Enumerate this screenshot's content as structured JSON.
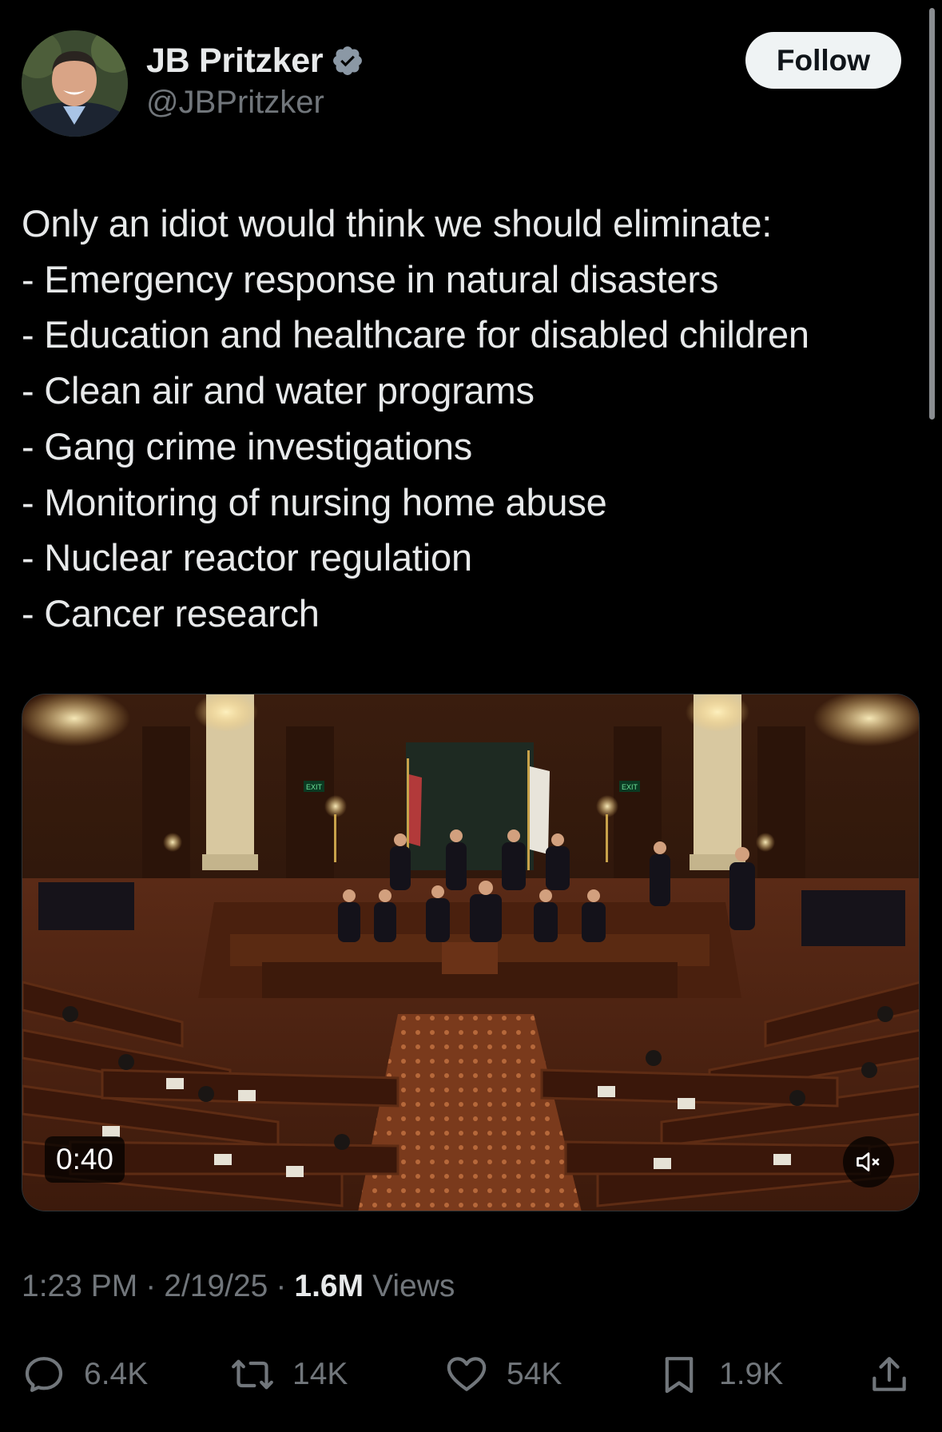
{
  "colors": {
    "background": "#000000",
    "text_primary": "#e7e9ea",
    "text_secondary": "#71767b",
    "verified_badge": "#8b98a5",
    "follow_button_bg": "#eff3f4"
  },
  "author": {
    "display_name": "JB Pritzker",
    "handle": "@JBPritzker",
    "verified_icon": "verified-badge-icon",
    "follow_label": "Follow"
  },
  "tweet": {
    "lines": [
      "Only an idiot would think we should eliminate:",
      "- Emergency response in natural disasters",
      "- Education and healthcare for disabled children",
      "- Clean air and water programs",
      "- Gang crime investigations",
      "- Monitoring of nursing home abuse",
      "- Nuclear reactor regulation",
      "- Cancer research"
    ]
  },
  "media": {
    "duration": "0:40",
    "mute_icon": "speaker-muted-icon",
    "exit_sign": "EXIT"
  },
  "meta": {
    "time": "1:23 PM",
    "separator": "·",
    "date": "2/19/25",
    "views_count": "1.6M",
    "views_label": "Views"
  },
  "actions": {
    "reply": {
      "icon": "reply-icon",
      "count": "6.4K"
    },
    "repost": {
      "icon": "repost-icon",
      "count": "14K"
    },
    "like": {
      "icon": "heart-icon",
      "count": "54K"
    },
    "bookmark": {
      "icon": "bookmark-icon",
      "count": "1.9K"
    },
    "share": {
      "icon": "share-icon"
    }
  }
}
